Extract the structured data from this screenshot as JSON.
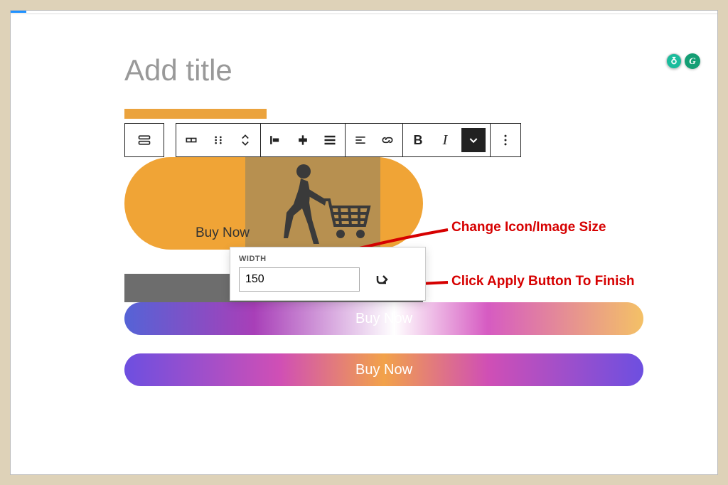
{
  "page": {
    "title_placeholder": "Add title"
  },
  "toolbar": {
    "bold": "B",
    "italic": "I"
  },
  "badges": {
    "o": "O",
    "g": "G"
  },
  "button_block": {
    "label": "Buy Now",
    "gray_label": " "
  },
  "width_popup": {
    "label": "WIDTH",
    "value": "150"
  },
  "annotations": {
    "size": "Change Icon/Image Size",
    "apply": "Click Apply Button To Finish"
  },
  "buy_buttons": {
    "b1": "Buy Now",
    "b2": "Buy Now"
  }
}
